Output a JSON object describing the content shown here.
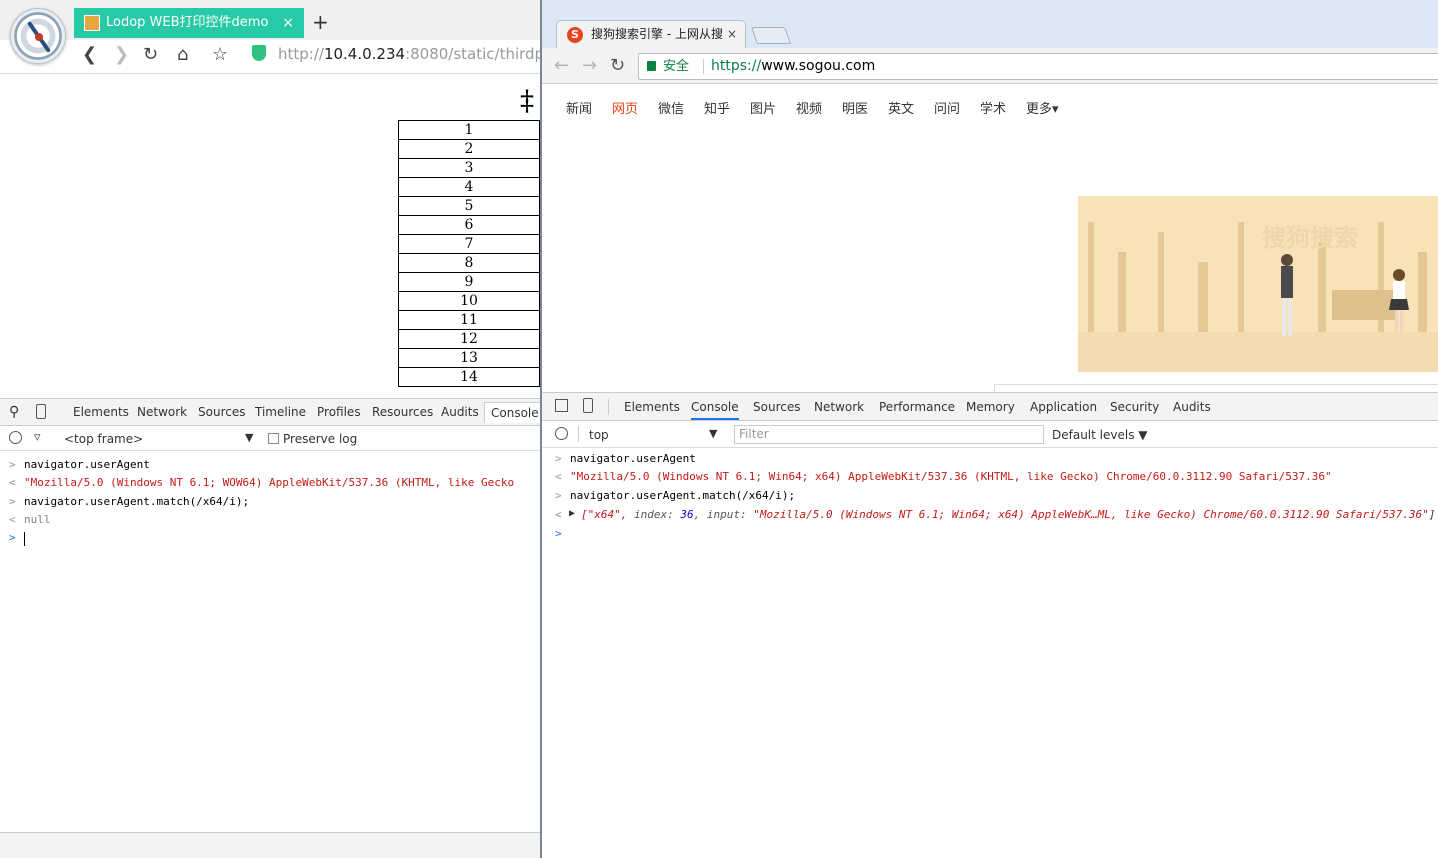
{
  "left": {
    "tab_title": "Lodop WEB打印控件demo",
    "tab_close": "×",
    "new_tab": "+",
    "url_prefix": "http://",
    "url_host": "10.4.0.234",
    "url_rest": ":8080/static/thirdp",
    "table_title_fragment": "‡",
    "table_rows": [
      "1",
      "2",
      "3",
      "4",
      "5",
      "6",
      "7",
      "8",
      "9",
      "10",
      "11",
      "12",
      "13",
      "14"
    ],
    "devtools": {
      "tabs": [
        "Elements",
        "Network",
        "Sources",
        "Timeline",
        "Profiles",
        "Resources",
        "Audits",
        "Console"
      ],
      "frame_select": "<top frame>",
      "preserve_log": "Preserve log",
      "lines": [
        {
          "type": "in",
          "text": "navigator.userAgent"
        },
        {
          "type": "out-str",
          "text": "\"Mozilla/5.0 (Windows NT 6.1; WOW64) AppleWebKit/537.36 (KHTML, like Gecko"
        },
        {
          "type": "in",
          "text": "navigator.userAgent.match(/x64/i);"
        },
        {
          "type": "out-null",
          "text": "null"
        }
      ]
    }
  },
  "right": {
    "tab_title": "搜狗搜索引擎 - 上网从搜",
    "tab_close": "×",
    "secure_label": "安全",
    "url_scheme": "https://",
    "url_host": "www.sogou.com",
    "nav": [
      "新闻",
      "网页",
      "微信",
      "知乎",
      "图片",
      "视频",
      "明医",
      "英文",
      "问问",
      "学术",
      "更多▾"
    ],
    "nav_active_index": 1,
    "banner_watermark": "搜狗搜索",
    "devtools": {
      "tabs": [
        "Elements",
        "Console",
        "Sources",
        "Network",
        "Performance",
        "Memory",
        "Application",
        "Security",
        "Audits"
      ],
      "context": "top",
      "filter_placeholder": "Filter",
      "levels": "Default levels ▼",
      "line1": "navigator.userAgent",
      "line2": "\"Mozilla/5.0 (Windows NT 6.1; Win64; x64) AppleWebKit/537.36 (KHTML, like Gecko) Chrome/60.0.3112.90 Safari/537.36\"",
      "line3": "navigator.userAgent.match(/x64/i);",
      "line4_open": "[\"x64\", ",
      "line4_index_key": "index: ",
      "line4_index_val": "36",
      "line4_input_key": ", input: ",
      "line4_input_val": "\"Mozilla/5.0 (Windows NT 6.1; Win64; x64) AppleWebK…ML, like Gecko) Chrome/60.0.3112.90 Safari/537.36\"",
      "line4_close": "]"
    }
  },
  "colors": {
    "left_tab": "#27c9a6",
    "sogou_accent": "#e8431c",
    "secure_green": "#0b8043",
    "console_string": "#c41a16"
  }
}
